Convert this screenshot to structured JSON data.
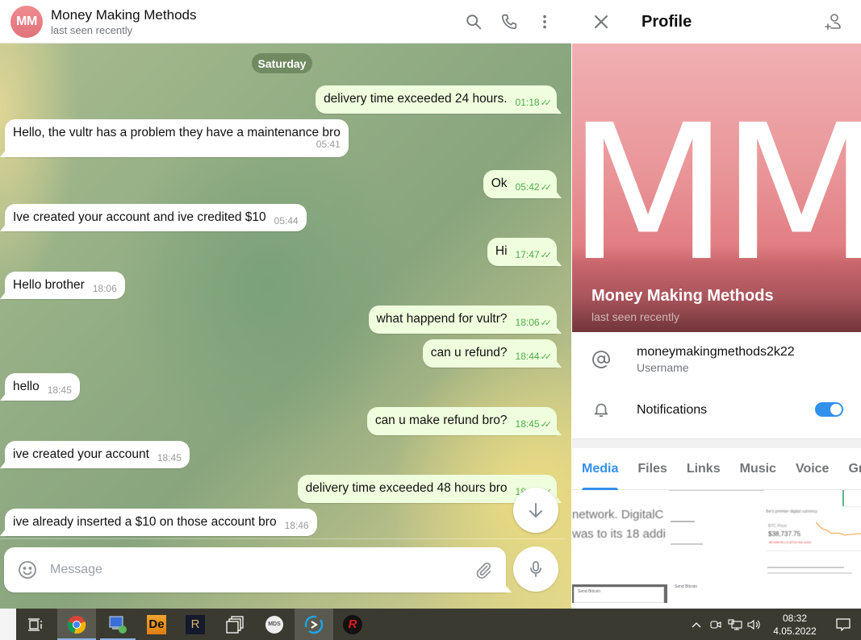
{
  "chat": {
    "title": "Money Making Methods",
    "status": "last seen recently",
    "avatar_initials": "MM",
    "header_icons": [
      "search-icon",
      "phone-icon",
      "more-vertical-icon"
    ],
    "date_chip": "Saturday",
    "messages": [
      {
        "dir": "out",
        "text": "delivery time exceeded 24 hours.",
        "time": "01:18",
        "read": true
      },
      {
        "dir": "in",
        "text": "Hello, the vultr has a problem they have a maintenance bro",
        "time": "05:41"
      },
      {
        "dir": "out",
        "text": "Ok",
        "time": "05:42",
        "read": true
      },
      {
        "dir": "in",
        "text": "Ive created your account and ive credited $10",
        "time": "05:44"
      },
      {
        "dir": "out",
        "text": "Hi",
        "time": "17:47",
        "read": true
      },
      {
        "dir": "in",
        "text": "Hello brother",
        "time": "18:06"
      },
      {
        "dir": "out",
        "text": "what happend for vultr?",
        "time": "18:06",
        "read": true
      },
      {
        "dir": "out",
        "text": "can u refund?",
        "time": "18:44",
        "read": true
      },
      {
        "dir": "in",
        "text": "hello",
        "time": "18:45"
      },
      {
        "dir": "out",
        "text": "can u make refund bro?",
        "time": "18:45",
        "read": true
      },
      {
        "dir": "in",
        "text": "ive created your account",
        "time": "18:45"
      },
      {
        "dir": "out",
        "text": "delivery time exceeded 48 hours bro",
        "time": "18:45",
        "read": true
      },
      {
        "dir": "in",
        "text": "ive already inserted a $10 on those account bro",
        "time": "18:46"
      }
    ],
    "composer": {
      "placeholder": "Message",
      "value": ""
    }
  },
  "profile": {
    "title": "Profile",
    "photo_initials": "MM",
    "name": "Money Making Methods",
    "status": "last seen recently",
    "username": "moneymakingmethods2k22",
    "username_label": "Username",
    "notifications_label": "Notifications",
    "notifications_on": true,
    "tabs": [
      {
        "label": "Media",
        "active": true
      },
      {
        "label": "Files",
        "active": false
      },
      {
        "label": "Links",
        "active": false
      },
      {
        "label": "Music",
        "active": false
      },
      {
        "label": "Voice",
        "active": false
      },
      {
        "label": "Gro",
        "active": false
      }
    ],
    "media_previews": {
      "cell1_line1": "network. DigitalC",
      "cell1_line2": "was to its 18 addi",
      "cell1_window": "Send Bitcoin",
      "cell2_window": "Send Bitcoin",
      "cell3_heading": "the's premier digital currency",
      "cell3_price_label": "BTC Price",
      "cell3_price": "$38,737.75",
      "cell3_change": "-$2,838.56 (-6.82%) this week"
    }
  },
  "taskbar": {
    "apps": [
      "task-view-icon",
      "chrome-icon",
      "remote-desktop-icon",
      "de-app-icon",
      "r-app-icon",
      "window-switcher-icon",
      "mds-icon",
      "s-app-icon",
      "red-r-app-icon"
    ],
    "time": "08:32",
    "date": "4.05.2022"
  },
  "colors": {
    "accent": "#3390ec",
    "outgoing_bubble": "#effedd",
    "outgoing_time": "#4fae4e",
    "avatar": "#e98085"
  }
}
